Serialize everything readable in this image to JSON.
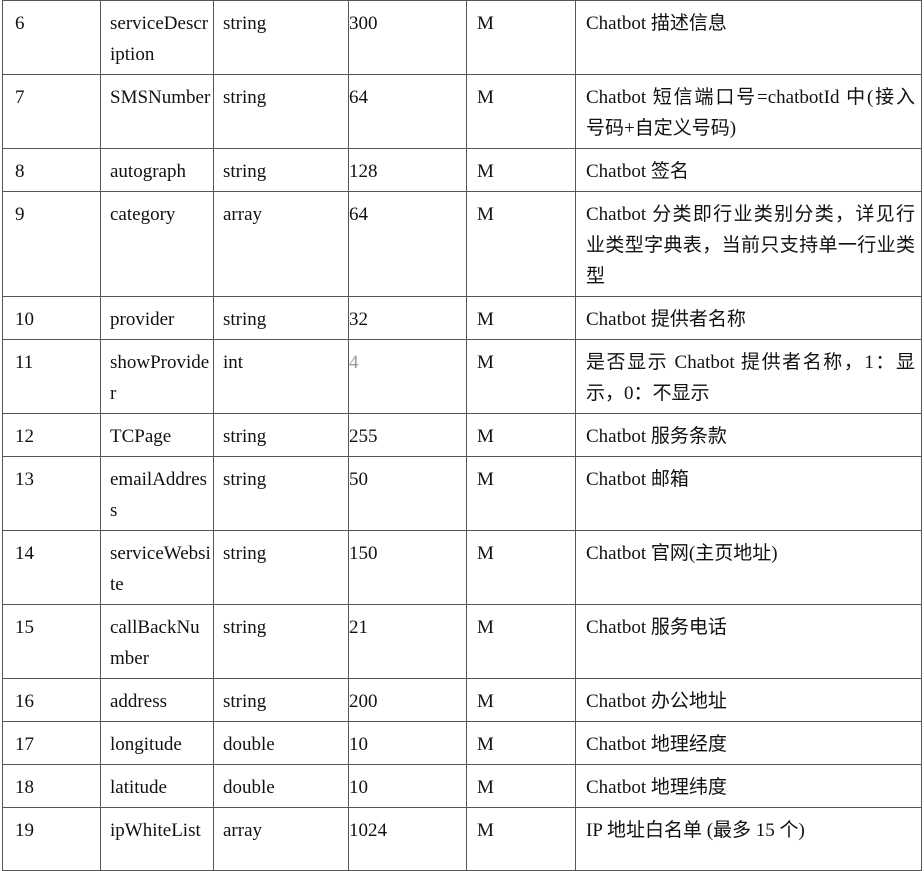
{
  "rows": [
    {
      "index": "6",
      "name": "serviceDescription",
      "type": "string",
      "length": "300",
      "required": "M",
      "description": "Chatbot 描述信息"
    },
    {
      "index": "7",
      "name": "SMSNumber",
      "type": "string",
      "length": "64",
      "required": "M",
      "description": "Chatbot 短信端口号=chatbotId 中(接入号码+自定义号码)"
    },
    {
      "index": "8",
      "name": "autograph",
      "type": "string",
      "length": "128",
      "required": "M",
      "description": "Chatbot 签名"
    },
    {
      "index": "9",
      "name": "category",
      "type": "array",
      "length": "64",
      "required": "M",
      "description": "Chatbot 分类即行业类别分类，详见行业类型字典表，当前只支持单一行业类型"
    },
    {
      "index": "10",
      "name": "provider",
      "type": "string",
      "length": "32",
      "required": "M",
      "description": "Chatbot 提供者名称"
    },
    {
      "index": "11",
      "name": "showProvider",
      "type": "int",
      "length": "4",
      "required": "M",
      "description": "是否显示 Chatbot 提供者名称，1：显示，0：不显示"
    },
    {
      "index": "12",
      "name": "TCPage",
      "type": "string",
      "length": "255",
      "required": "M",
      "description": "Chatbot 服务条款"
    },
    {
      "index": "13",
      "name": "emailAddress",
      "type": "string",
      "length": "50",
      "required": "M",
      "description": "Chatbot 邮箱"
    },
    {
      "index": "14",
      "name": "serviceWebsite",
      "type": "string",
      "length": "150",
      "required": "M",
      "description": "Chatbot 官网(主页地址)"
    },
    {
      "index": "15",
      "name": "callBackNumber",
      "type": "string",
      "length": "21",
      "required": "M",
      "description": "Chatbot 服务电话"
    },
    {
      "index": "16",
      "name": "address",
      "type": "string",
      "length": "200",
      "required": "M",
      "description": "Chatbot 办公地址"
    },
    {
      "index": "17",
      "name": "longitude",
      "type": "double",
      "length": "10",
      "required": "M",
      "description": "Chatbot 地理经度"
    },
    {
      "index": "18",
      "name": "latitude",
      "type": "double",
      "length": "10",
      "required": "M",
      "description": "Chatbot 地理纬度"
    },
    {
      "index": "19",
      "name": "ipWhiteList",
      "type": "array",
      "length": "1024",
      "required": "M",
      "description": "IP 地址白名单 (最多 15 个)"
    }
  ]
}
